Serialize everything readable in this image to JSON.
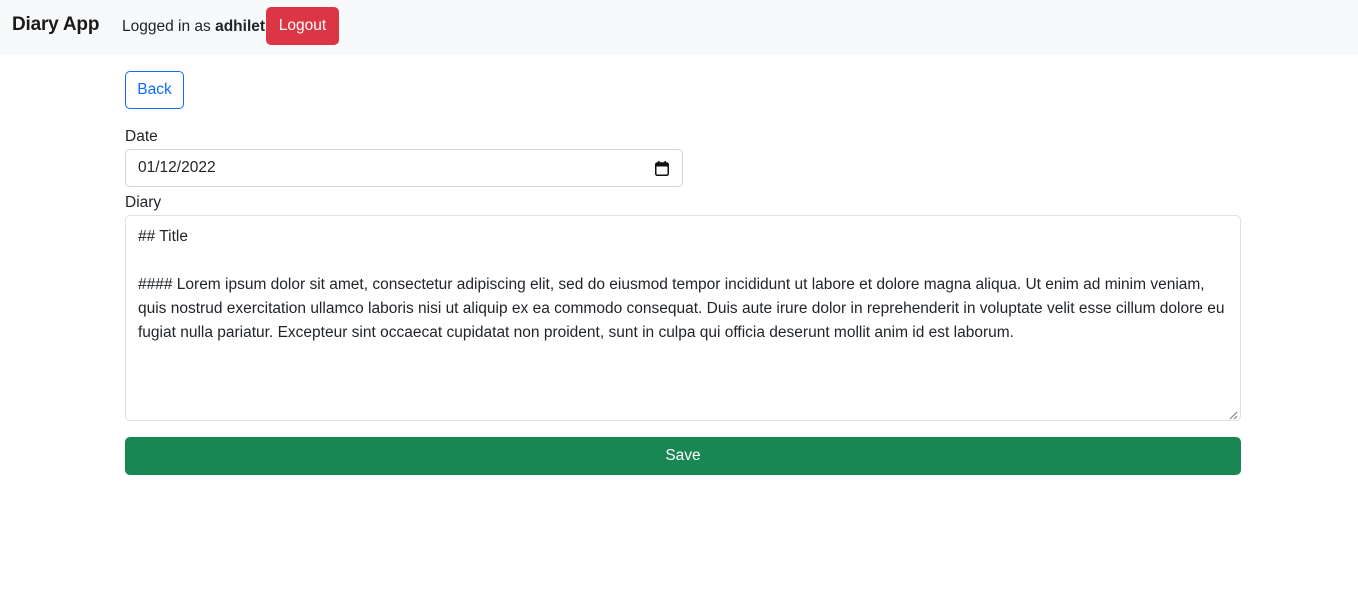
{
  "navbar": {
    "brand": "Diary App",
    "logged_in_prefix": "Logged in as",
    "username": "adhilet",
    "logout_label": "Logout",
    "logout_color": "#dc3545"
  },
  "form": {
    "back_label": "Back",
    "date_label": "Date",
    "date_value": "01/12/2022",
    "diary_label": "Diary",
    "diary_value": "## Title\n\n#### Lorem ipsum dolor sit amet, consectetur adipiscing elit, sed do eiusmod tempor incididunt ut labore et dolore magna aliqua. Ut enim ad minim veniam, quis nostrud exercitation ullamco laboris nisi ut aliquip ex ea commodo consequat. Duis aute irure dolor in reprehenderit in voluptate velit esse cillum dolore eu fugiat nulla pariatur. Excepteur sint occaecat cupidatat non proident, sunt in culpa qui officia deserunt mollit anim id est laborum.",
    "save_label": "Save",
    "save_color": "#198754",
    "accent_color": "#0d6efd"
  },
  "icons": {
    "calendar": "calendar-icon",
    "resize": "resize-grip-icon"
  }
}
